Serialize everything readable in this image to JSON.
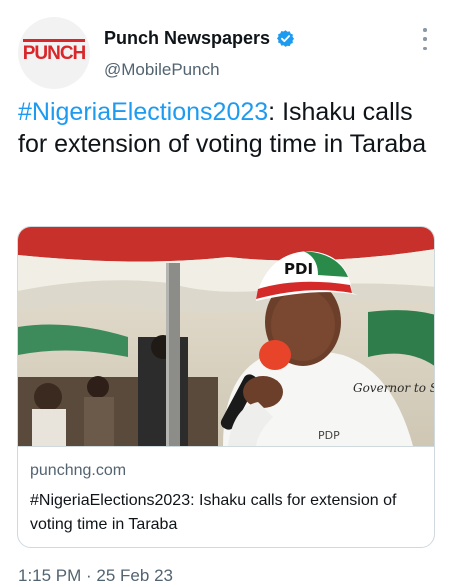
{
  "author": {
    "display_name": "Punch Newspapers",
    "handle": "@MobilePunch",
    "avatar_logo_text": "PUNCH",
    "verified_icon": "verified-badge-icon",
    "brand_color": "#d9262a"
  },
  "tweet": {
    "hashtag": "#NigeriaElections2023",
    "text_rest": ": Ishaku calls for extension of voting time in Taraba"
  },
  "card": {
    "domain": "punchng.com",
    "title": "#NigeriaElections2023: Ishaku calls for extension of voting time in Taraba",
    "image_cap_text": "PDI",
    "image_shirt_text": "Governor to Sahari",
    "image_shirt_text2": "PDP"
  },
  "meta": {
    "timestamp": "1:15 PM · 25 Feb 23"
  },
  "colors": {
    "link": "#1d9bf0",
    "secondary_text": "#536471",
    "border": "#cfd9de"
  }
}
